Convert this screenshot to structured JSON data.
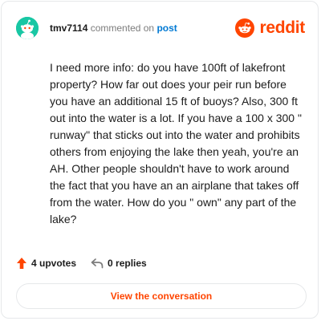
{
  "header": {
    "username": "tmv7114",
    "action_text": "commented on",
    "post_link_label": "post",
    "brand_name": "reddit",
    "avatar_icon": "snoo-avatar-icon",
    "brand_icon": "reddit-logo-icon"
  },
  "comment": {
    "body": "I need more info: do you have 100ft of lakefront property? How far out does your peir run before you have an additional 15 ft of buoys? Also, 300 ft out into the water is a lot. If you have a 100 x 300 \" runway\" that sticks out into the water and prohibits others from enjoying the lake then yeah, you're an AH. Other people shouldn't have to work around the fact that you have an an airplane that takes off from the water. How do you \" own\" any part of the lake?"
  },
  "stats": {
    "upvotes_label": "4 upvotes",
    "replies_label": "0 replies",
    "upvote_icon": "upvote-arrow-icon",
    "reply_icon": "reply-arrow-icon"
  },
  "cta": {
    "label": "View the conversation"
  },
  "colors": {
    "brand": "#ff4500",
    "link": "#0079d3",
    "avatar_bg": "#18c7a4",
    "text": "#1c1c1c",
    "muted": "#7c7c7c",
    "border": "#e6e8ea"
  }
}
